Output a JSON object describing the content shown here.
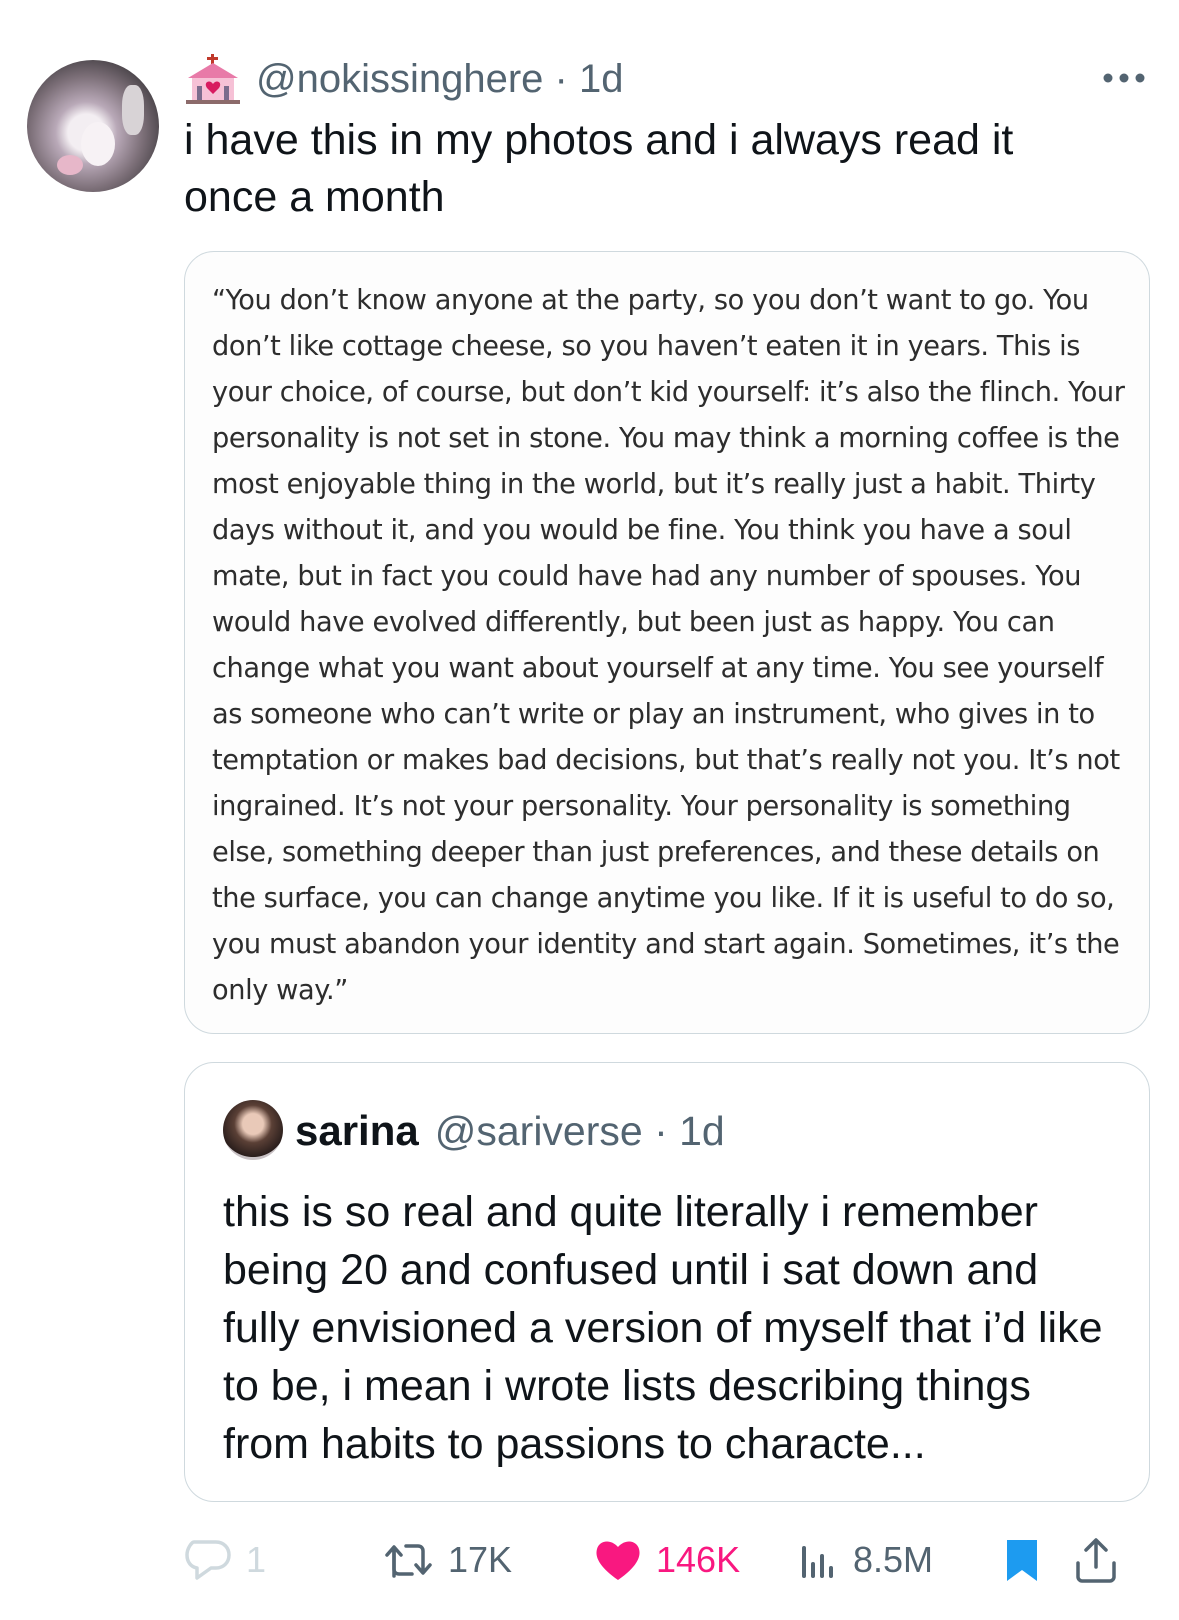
{
  "tweet": {
    "handle_line": "@nokissinghere · 1d",
    "text": "i have this in my photos and i always read it once a month",
    "badge_icon": "wedding-chapel-icon",
    "menu_icon": "more-dots-icon"
  },
  "image_text": "“You don’t know anyone at the party, so you don’t want to go. You don’t like cottage cheese, so you haven’t eaten it in years. This is your choice, of course, but don’t kid yourself: it’s also the flinch. Your personality is not set in stone. You may think a morning coffee is the most enjoyable thing in the world, but it’s really just a habit. Thirty days without it, and you would be fine. You think you have a soul mate, but in fact you could have had any number of spouses. You would have evolved differently, but been just as happy. You can change what you want about yourself at any time. You see yourself as someone who can’t write or play an instrument, who gives in to temptation or makes bad decisions, but that’s really not you. It’s not ingrained. It’s not your personality. Your personality is something else, something deeper than just preferences, and these details on the surface, you can change anytime you like. If it is useful to do so, you must abandon your identity and start again. Sometimes, it’s the only way.”",
  "quoted": {
    "name": "sarina",
    "handle_line": "@sariverse · 1d",
    "text": "this is so real and quite literally i remember being 20 and confused until i sat down and fully envisioned a version of myself that i’d like to be, i mean i wrote lists describing things from habits to passions to characte..."
  },
  "actions": {
    "replies": "1",
    "retweets": "17K",
    "likes": "146K",
    "views": "8.5M"
  },
  "colors": {
    "accent_like": "#f91880",
    "accent_bookmark": "#1d9bf0",
    "muted": "#536471",
    "border": "#cfd9de"
  }
}
